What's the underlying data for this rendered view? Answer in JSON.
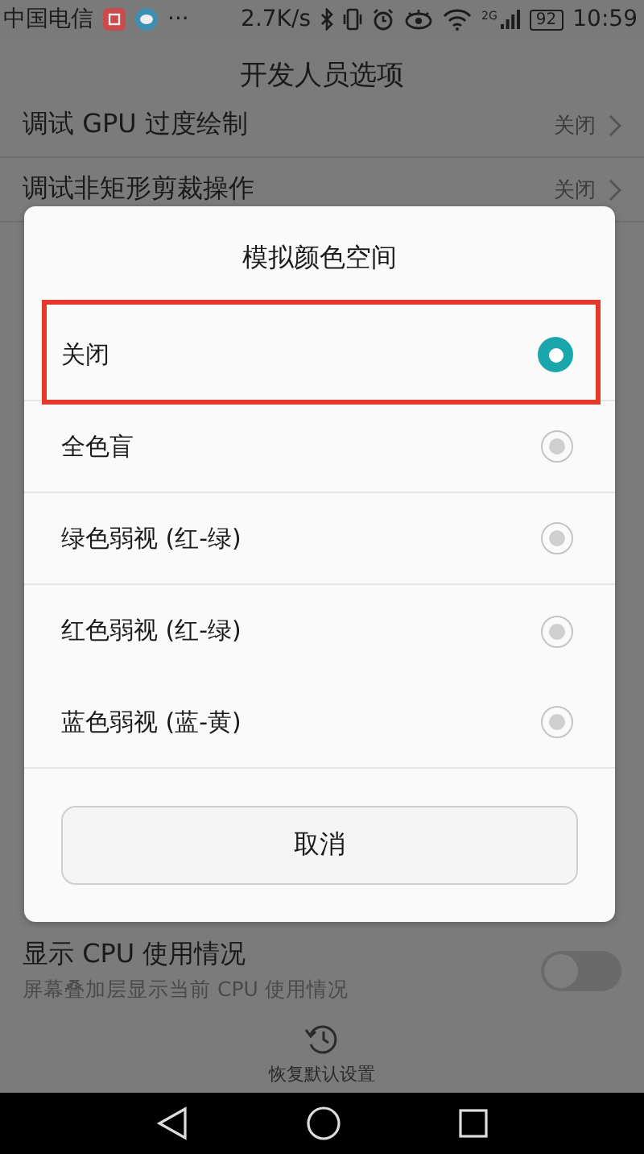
{
  "status_bar": {
    "carrier": "中国电信",
    "more": "···",
    "speed": "2.7K/s",
    "network": "2G",
    "battery": "92",
    "time": "10:59"
  },
  "header": {
    "title": "开发人员选项"
  },
  "settings": [
    {
      "kind": "link",
      "title": "调试 GPU 过度绘制",
      "value": "关闭"
    },
    {
      "kind": "link",
      "title": "调试非矩形剪裁操作",
      "value": "关闭"
    },
    {
      "kind": "toggle",
      "title": "显示 CPU 使用情况",
      "subtitle": "屏幕叠加层显示当前 CPU 使用情况",
      "on": false
    }
  ],
  "dialog": {
    "title": "模拟颜色空间",
    "options": [
      {
        "label": "关闭",
        "selected": true,
        "highlighted": true
      },
      {
        "label": "全色盲",
        "selected": false,
        "highlighted": false
      },
      {
        "label": "绿色弱视 (红-绿)",
        "selected": false,
        "highlighted": false
      },
      {
        "label": "红色弱视 (红-绿)",
        "selected": false,
        "highlighted": false
      },
      {
        "label": "蓝色弱视 (蓝-黄)",
        "selected": false,
        "highlighted": false
      }
    ],
    "cancel": "取消"
  },
  "footer": {
    "restore": "恢复默认设置"
  }
}
